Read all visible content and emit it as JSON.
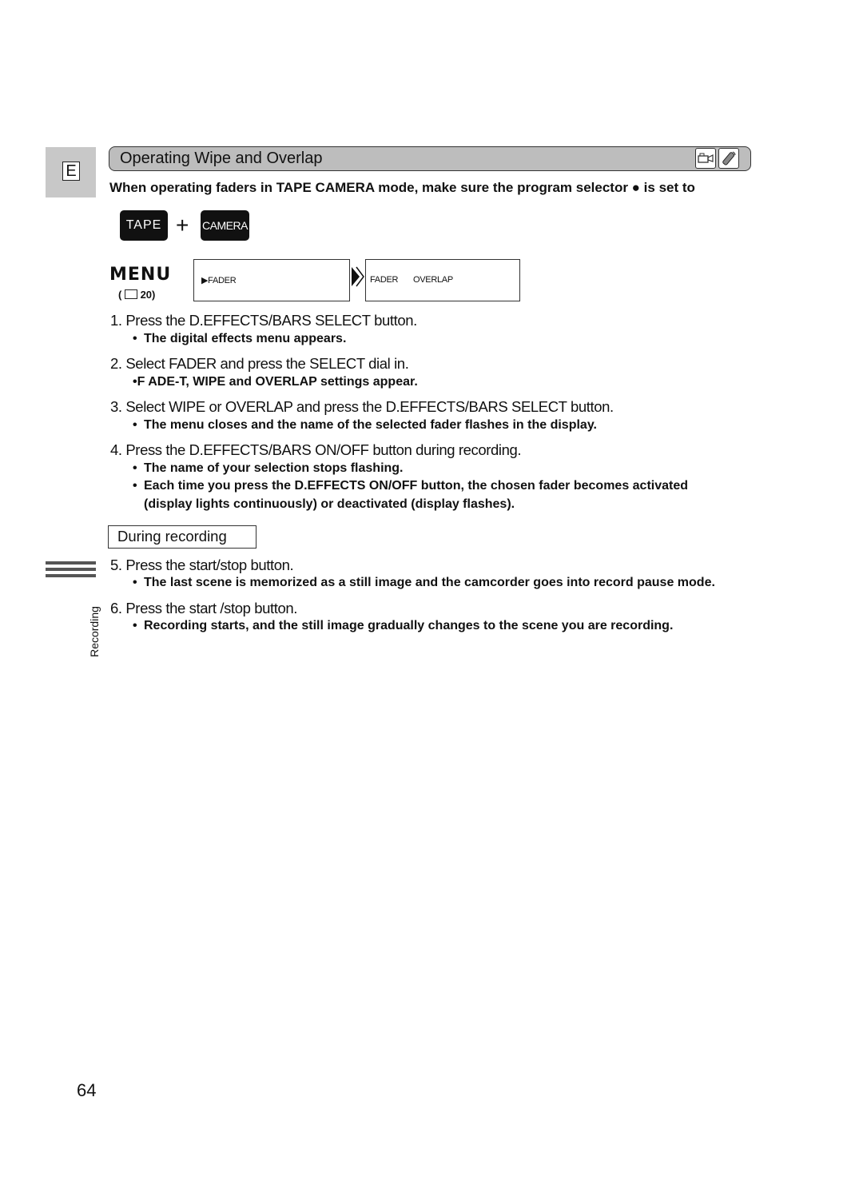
{
  "language_tab": "E",
  "title": "Operating Wipe and Overlap",
  "title_icons": [
    "camcorder-icon",
    "remote-control-icon"
  ],
  "intro": "When operating faders in TAPE CAMERA mode, make sure the program selector ● is set to",
  "modes": {
    "tape": "TAPE",
    "plus": "+",
    "camera": "CAMERA"
  },
  "menu": {
    "label": "MENU",
    "reference": "( 🕮 20)",
    "screen1": "▶FADER",
    "screen2_item1": "FADER",
    "screen2_item2": "OVERLAP"
  },
  "steps": [
    {
      "text": "1.  Press the D.EFFECTS/BARS SELECT button.",
      "notes": [
        "The digital effects menu appears."
      ]
    },
    {
      "text": "2.  Select FADER and press the SELECT dial in.",
      "notes": [
        "•F ADE-T, WIPE and OVERLAP settings appear."
      ]
    },
    {
      "text": "3.  Select WIPE or OVERLAP and press the D.EFFECTS/BARS SELECT button.",
      "notes": [
        "The menu closes and the name of the selected fader flashes in the display."
      ]
    },
    {
      "text": "4.  Press the D.EFFECTS/BARS ON/OFF button during recording.",
      "notes": [
        "The name of your selection stops flashing.",
        "Each time you press the D.EFFECTS ON/OFF button, the chosen fader becomes activated",
        "(display lights continuously) or deactivated (display flashes)."
      ]
    },
    {
      "text": "5.  Press the start/stop button.",
      "notes": [
        "The last scene is memorized as a still image and the camcorder goes into record pause mode."
      ]
    },
    {
      "text": "6.  Press the start /stop button.",
      "notes": [
        "Recording starts, and the still image gradually changes to the scene you are recording."
      ]
    }
  ],
  "during_recording": "During recording",
  "side_label": "Recording",
  "bullet": "•",
  "page_number": "64"
}
